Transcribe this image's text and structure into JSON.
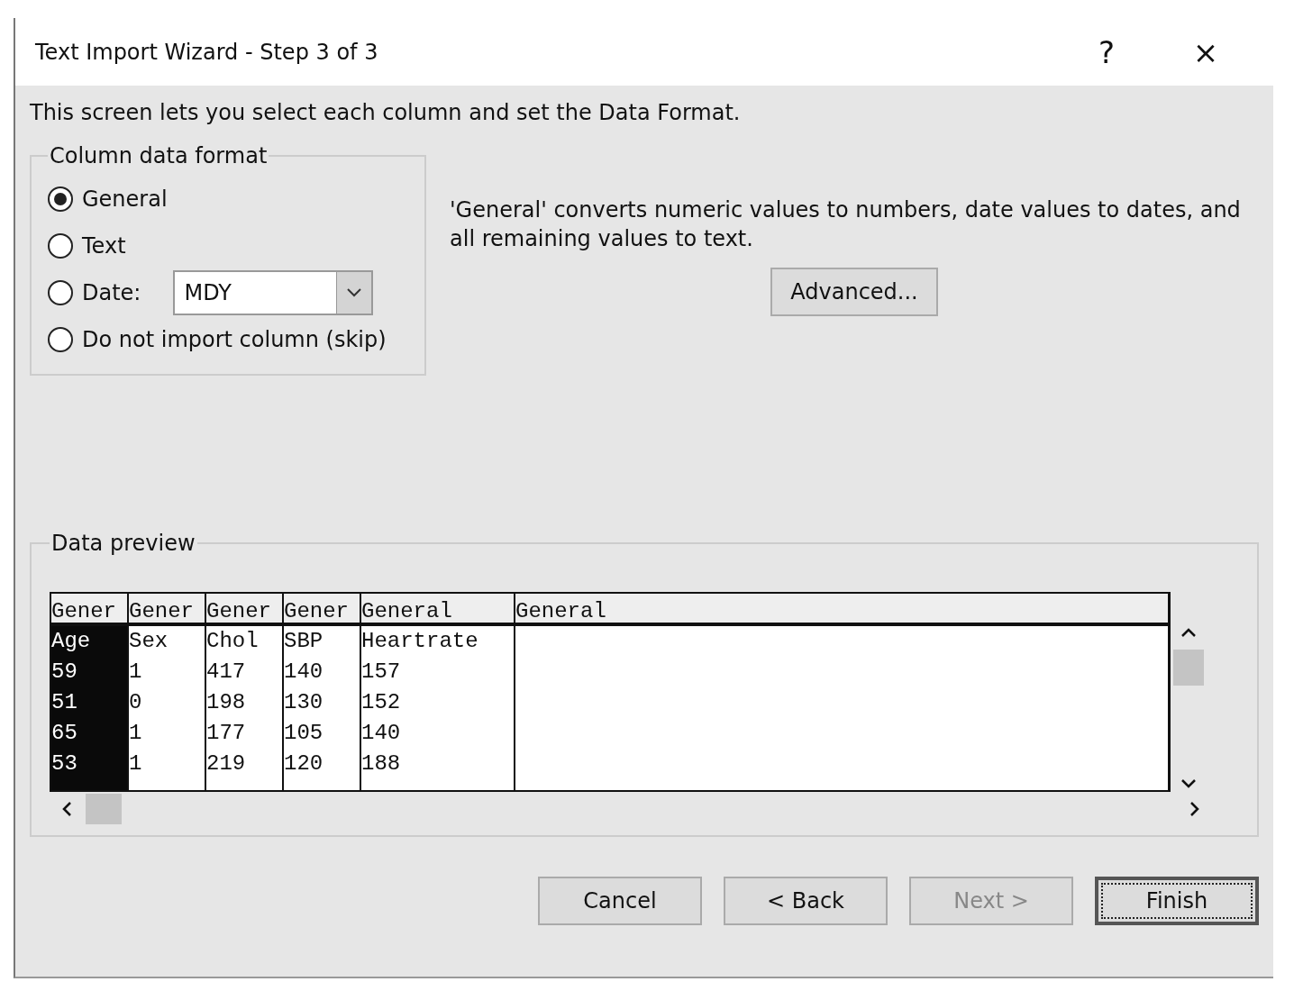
{
  "window": {
    "title": "Text Import Wizard - Step 3 of 3",
    "controls": [
      "?",
      "×"
    ]
  },
  "intro": "This screen lets you select each column and set the Data Format.",
  "format_group": {
    "legend": "Column data format",
    "options": [
      {
        "label": "General",
        "selected": true,
        "kind": "plain"
      },
      {
        "label": "Text",
        "selected": false,
        "kind": "plain"
      },
      {
        "label": "Date:",
        "selected": false,
        "kind": "date",
        "dropdown_value": "MDY"
      },
      {
        "label": "Do not import column (skip)",
        "selected": false,
        "kind": "plain"
      }
    ]
  },
  "description": "'General' converts numeric values to numbers, date values to dates, and all remaining values to text.",
  "advanced_button": "Advanced...",
  "preview": {
    "legend": "Data preview",
    "columns": [
      {
        "header": "Gener",
        "selected": true,
        "kind": "narrow"
      },
      {
        "header": "Gener",
        "selected": false,
        "kind": "narrow"
      },
      {
        "header": "Gener",
        "selected": false,
        "kind": "narrow"
      },
      {
        "header": "Gener",
        "selected": false,
        "kind": "narrow"
      },
      {
        "header": "General",
        "selected": false,
        "kind": "wide"
      },
      {
        "header": "General",
        "selected": false,
        "kind": "fill"
      }
    ],
    "rows": [
      [
        "Age",
        "Sex",
        "Chol",
        "SBP",
        "Heartrate"
      ],
      [
        "59",
        "1",
        "417",
        "140",
        "157"
      ],
      [
        "51",
        "0",
        "198",
        "130",
        "152"
      ],
      [
        "65",
        "1",
        "177",
        "105",
        "140"
      ],
      [
        "53",
        "1",
        "219",
        "120",
        "188"
      ]
    ]
  },
  "buttons": [
    {
      "label": "Cancel",
      "disabled": false,
      "default": false
    },
    {
      "label": "< Back",
      "disabled": false,
      "default": false
    },
    {
      "label": "Next >",
      "disabled": true,
      "default": false
    },
    {
      "label": "Finish",
      "disabled": false,
      "default": true
    }
  ]
}
